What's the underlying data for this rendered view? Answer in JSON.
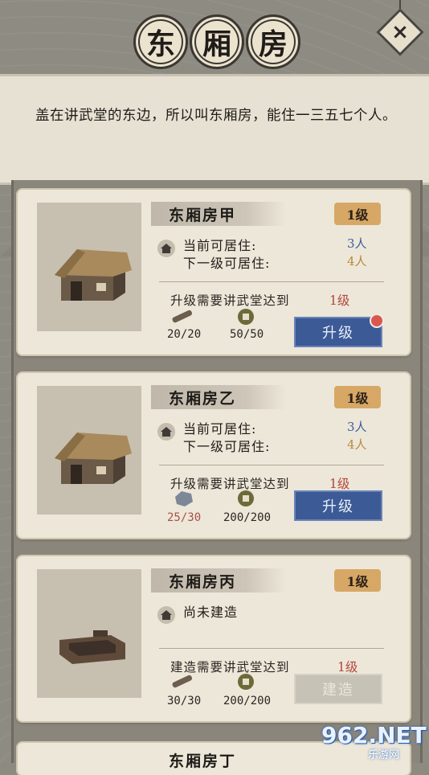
{
  "title": {
    "chars": [
      "东",
      "厢",
      "房"
    ]
  },
  "close_button": {
    "icon": "close-icon",
    "label": "×"
  },
  "description": "盖在讲武堂的东边，所以叫东厢房，能住一三五七个人。",
  "labels": {
    "current_capacity": "当前可居住:",
    "next_capacity": "下一级可居住:",
    "not_built": "尚未建造"
  },
  "buildings": [
    {
      "name": "东厢房甲",
      "level": "1级",
      "current": "3人",
      "next": "4人",
      "requirement": "升级需要讲武堂达到",
      "requirement_level": "1级",
      "cost_1": "20/20",
      "cost_1_icon": "wood-icon",
      "cost_2": "50/50",
      "cost_2_icon": "coin-icon",
      "button": "升级",
      "notification": true
    },
    {
      "name": "东厢房乙",
      "level": "1级",
      "current": "3人",
      "next": "4人",
      "requirement": "升级需要讲武堂达到",
      "requirement_level": "1级",
      "cost_1": "25/30",
      "cost_1_icon": "stone-icon",
      "cost_2": "200/200",
      "cost_2_icon": "coin-icon",
      "button": "升级",
      "notification": false
    },
    {
      "name": "东厢房丙",
      "level": "1级",
      "status": "尚未建造",
      "requirement": "建造需要讲武堂达到",
      "requirement_level": "1级",
      "cost_1": "30/30",
      "cost_1_icon": "wood-icon",
      "cost_2": "200/200",
      "cost_2_icon": "coin-icon",
      "button": "建造",
      "button_disabled": true
    }
  ],
  "partial_building_name": "东厢房丁",
  "watermark": {
    "main": "962.NET",
    "sub": "乐游网"
  },
  "colors": {
    "button_blue": "#3b5a96",
    "level_badge": "#d7a865",
    "value_blue": "#3d5c9d",
    "value_gold": "#b98a3c",
    "requirement_red": "#b3473d"
  }
}
